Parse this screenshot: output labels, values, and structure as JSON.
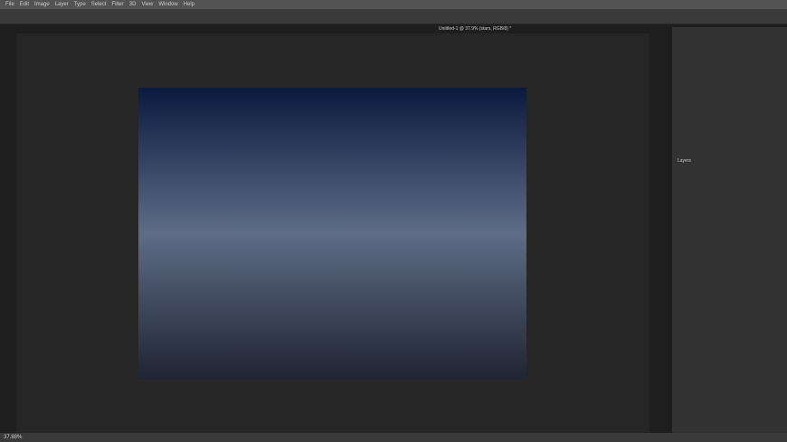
{
  "menu": [
    "File",
    "Edit",
    "Image",
    "Layer",
    "Type",
    "Select",
    "Filter",
    "3D",
    "View",
    "Window",
    "Help"
  ],
  "active_tab": "Untitled-1 @ 37.9% (stars, RGB/8) *",
  "layers_panel": {
    "tab": "Layers"
  },
  "status": {
    "zoom": "37.88%"
  }
}
